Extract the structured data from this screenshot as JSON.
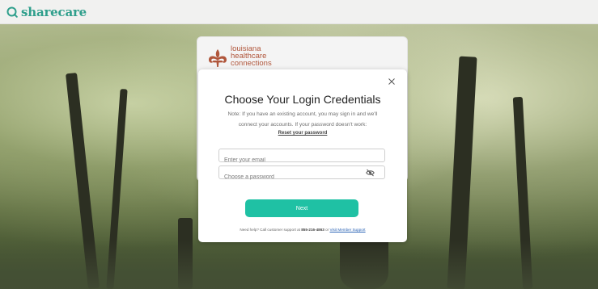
{
  "brand": {
    "name": "sharecare"
  },
  "partner": {
    "line1": "louisiana",
    "line2": "healthcare",
    "line3": "connections"
  },
  "modal": {
    "title": "Choose Your Login Credentials",
    "note_line1": "Note: If you have an existing account, you may sign in and we'll",
    "note_line2": "connect your accounts. If your password doesn't work:",
    "reset_link": "Reset your password",
    "email_placeholder": "Enter your email",
    "password_placeholder": "Choose a password",
    "next_label": "Next",
    "help_prefix": "Need help? Call customer support at",
    "help_phone": "855-216-4863",
    "help_or": "or",
    "help_link": "Visit Member Support"
  },
  "icons": {
    "close": "close-icon",
    "eye": "eye-off-icon",
    "logo": "sharecare-logo-icon",
    "fleur": "fleur-de-lis-icon"
  }
}
